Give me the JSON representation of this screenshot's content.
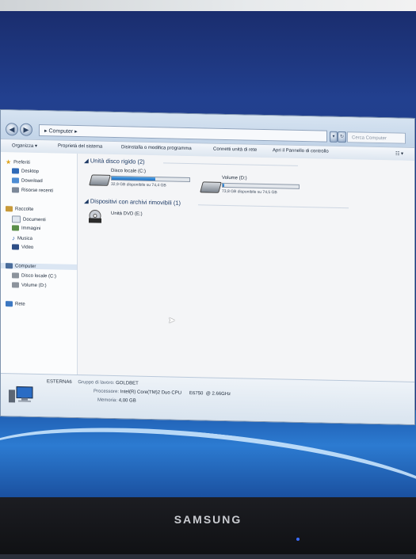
{
  "window": {
    "address": "Computer",
    "search_placeholder": "Cerca Computer"
  },
  "toolbar": {
    "items": [
      "Organizza",
      "Proprietà del sistema",
      "Disinstalla o modifica programma",
      "Connetti unità di rete",
      "Apri il Pannello di controllo"
    ]
  },
  "sidebar": {
    "favorites": {
      "label": "Preferiti",
      "items": [
        "Desktop",
        "Download",
        "Risorse recenti"
      ]
    },
    "libraries": {
      "label": "Raccolte",
      "items": [
        "Documenti",
        "Immagini",
        "Musica",
        "Video"
      ]
    },
    "computer": {
      "label": "Computer",
      "items": [
        "Disco locale (C:)",
        "Volume (D:)"
      ]
    },
    "network": {
      "label": "Rete"
    }
  },
  "main": {
    "hard_disks_title": "Unità disco rigido (2)",
    "removable_title": "Dispositivi con archivi rimovibili (1)",
    "drives": [
      {
        "name": "Disco locale (C:)",
        "free": "32,9 GB disponibile su 74,4 GB",
        "used_fraction": 0.56
      },
      {
        "name": "Volume (D:)",
        "free": "73,8 GB disponibile su 74,5 GB",
        "used_fraction": 0.01
      }
    ],
    "dvd": {
      "name": "Unità DVD (E:)"
    }
  },
  "details": {
    "computer_name": "ESTERNA6",
    "workgroup_label": "Gruppo di lavoro:",
    "workgroup": "GOLDBET",
    "processor_label": "Processore:",
    "processor": "Intel(R) Core(TM)2 Duo CPU      E6750  @ 2.66GHz",
    "memory_label": "Memoria:",
    "memory": "4,00 GB"
  },
  "monitor": {
    "brand": "SAMSUNG"
  },
  "colors": {
    "accent": "#1f6fc0",
    "desktop": "#1d3a86"
  }
}
